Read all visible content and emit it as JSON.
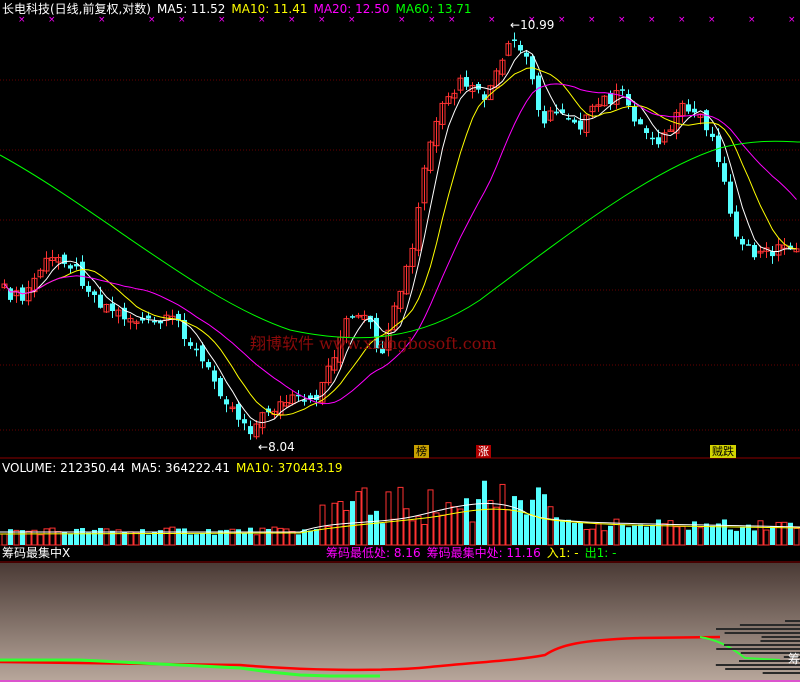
{
  "header": {
    "title": "长电科技(日线,前复权,对数)",
    "ma5": "MA5: 11.52",
    "ma10": "MA10: 11.41",
    "ma20": "MA20: 12.50",
    "ma60": "MA60: 13.71"
  },
  "colors": {
    "up": "#ff3232",
    "down": "#54ffff",
    "ma5": "#ffffff",
    "ma10": "#ffff00",
    "ma20": "#ff00ff",
    "ma60": "#00ff00",
    "grid": "#8b0000",
    "magenta_marks": "#ff00ff"
  },
  "annotations": {
    "high": "10.99",
    "low": "8.04",
    "watermark": "翔博软件 www.xiangbosoft.com",
    "badge_bang": "榜",
    "badge_zhang": "涨",
    "badge_die": "贼跌"
  },
  "volume_header": {
    "volume": "VOLUME: 212350.44",
    "ma5": "MA5: 364222.41",
    "ma10": "MA10: 370443.19"
  },
  "chip_header": {
    "name": "筹码最集中X",
    "lowest": "筹码最低处: 8.16",
    "center": "筹码最集中处: 11.16",
    "in": "入1: -",
    "out": "出1: -"
  },
  "chip_side_label": "筹",
  "chart_data": [
    {
      "type": "candlestick",
      "title": "长电科技(日线,前复权,对数)",
      "series": [
        {
          "name": "MA5",
          "values": [
            11.52
          ]
        },
        {
          "name": "MA10",
          "values": [
            11.41
          ]
        },
        {
          "name": "MA20",
          "values": [
            12.5
          ]
        },
        {
          "name": "MA60",
          "values": [
            13.71
          ]
        }
      ],
      "points": {
        "high": 10.99,
        "low": 8.04
      }
    },
    {
      "type": "bar",
      "title": "VOLUME",
      "series": [
        {
          "name": "VOLUME",
          "values": [
            212350.44
          ]
        },
        {
          "name": "MA5",
          "values": [
            364222.41
          ]
        },
        {
          "name": "MA10",
          "values": [
            370443.19
          ]
        }
      ]
    },
    {
      "type": "area",
      "title": "筹码最集中X",
      "values": {
        "lowest": 8.16,
        "center": 11.16
      }
    }
  ]
}
